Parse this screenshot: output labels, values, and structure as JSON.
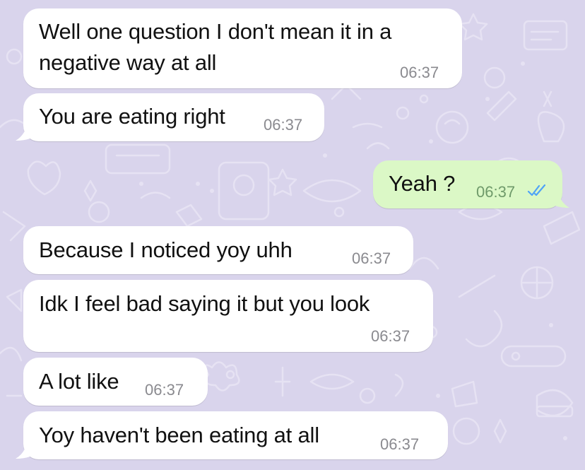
{
  "theme": {
    "wallpaper": "#d9d4ec",
    "incoming_bubble": "#ffffff",
    "outgoing_bubble": "#dbf8c6",
    "read_ticks": "#4fa3f7"
  },
  "messages": [
    {
      "direction": "in",
      "text_lines": [
        "Well one question I don't mean it in a",
        "negative way at all"
      ],
      "time": "06:37"
    },
    {
      "direction": "in",
      "text": "You are eating right",
      "time": "06:37"
    },
    {
      "direction": "out",
      "text": "Yeah ?",
      "time": "06:37",
      "status": "read"
    },
    {
      "direction": "in",
      "text": "Because I noticed yoy uhh",
      "time": "06:37"
    },
    {
      "direction": "in",
      "text": "Idk I feel bad saying it but you look",
      "time": "06:37"
    },
    {
      "direction": "in",
      "text": "A lot like",
      "time": "06:37"
    },
    {
      "direction": "in",
      "text": "Yoy haven't been eating at all",
      "time": "06:37"
    }
  ]
}
